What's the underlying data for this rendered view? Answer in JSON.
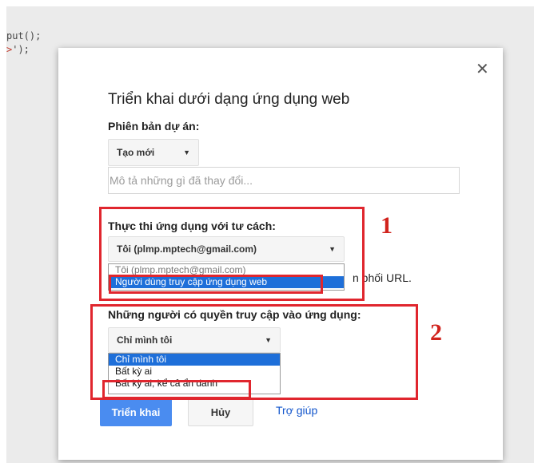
{
  "editor": {
    "code_line_1": "put();",
    "code_line_2_a": ">",
    "code_line_2_b": "');"
  },
  "dialog": {
    "title": "Triển khai dưới dạng ứng dụng web",
    "close_icon": "close-icon",
    "version_section": {
      "label": "Phiên bản dự án:",
      "select_value": "Tạo mới",
      "description_placeholder": "Mô tả những gì đã thay đổi..."
    },
    "execute_section": {
      "label": "Thực thi ứng dụng với tư cách:",
      "selected": "Tôi (plmp.mptech@gmail.com)",
      "options": [
        "Tôi (plmp.mptech@gmail.com)",
        "Người dùng truy cập ứng dụng web"
      ],
      "partial_text": "n phối URL."
    },
    "access_section": {
      "label": "Những người có quyền truy cập vào ứng dụng:",
      "selected": "Chỉ mình tôi",
      "options": [
        "Chỉ mình tôi",
        "Bất kỳ ai",
        "Bất kỳ ai, kể cả ẩn danh"
      ]
    },
    "buttons": {
      "deploy": "Triển khai",
      "cancel": "Hủy",
      "help": "Trợ giúp"
    }
  },
  "annotations": {
    "label_1": "1",
    "label_2": "2",
    "color": "#e0262e"
  }
}
